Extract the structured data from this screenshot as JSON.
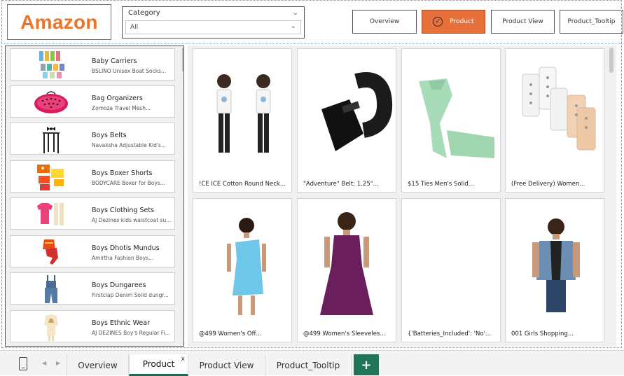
{
  "header": {
    "logo_text": "Amazon",
    "slicer": {
      "title": "Category",
      "value": "All"
    },
    "nav_buttons": [
      {
        "label": "Overview",
        "active": false
      },
      {
        "label": "Product",
        "active": true
      },
      {
        "label": "Product View",
        "active": false
      },
      {
        "label": "Product_Tooltip",
        "active": false
      }
    ]
  },
  "categories": [
    {
      "name": "Baby Carriers",
      "desc": "BSLINO Unisex Boat Socks..."
    },
    {
      "name": "Bag Organizers",
      "desc": "Zomoza Travel Mesh..."
    },
    {
      "name": "Boys Belts",
      "desc": "Navaksha Adjustable Kid's..."
    },
    {
      "name": "Boys Boxer Shorts",
      "desc": "BODYCARE Boxer for Boys..."
    },
    {
      "name": "Boys Clothing Sets",
      "desc": "AJ Dezines kids waistcoat su..."
    },
    {
      "name": "Boys Dhotis Mundus",
      "desc": "Amirtha Fashion Boys..."
    },
    {
      "name": "Boys Dungarees",
      "desc": "Firstclap Denim Solid dungr..."
    },
    {
      "name": "Boys Ethnic Wear",
      "desc": "AJ DEZINES Boy's Regular Fi..."
    }
  ],
  "products": [
    {
      "name": "!CE ICE Cotton Round Neck..."
    },
    {
      "name": "\"Adventure\" Belt; 1.25\"..."
    },
    {
      "name": "$15 Ties Men's Solid..."
    },
    {
      "name": "(Free Delivery) Women..."
    },
    {
      "name": "@499 Women's Off..."
    },
    {
      "name": "@499 Women's Sleeveles..."
    },
    {
      "name": "{'Batteries_Included': 'No'..."
    },
    {
      "name": "001 Girls Shopping..."
    }
  ],
  "tabs": [
    {
      "label": "Overview",
      "active": false
    },
    {
      "label": "Product",
      "active": true
    },
    {
      "label": "Product View",
      "active": false
    },
    {
      "label": "Product_Tooltip",
      "active": false
    }
  ],
  "tabbar": {
    "add_symbol": "+",
    "close_symbol": "x"
  },
  "colors": {
    "accent": "#e8703a",
    "logo": "#e8752a",
    "tab_accent": "#1f6b52"
  }
}
